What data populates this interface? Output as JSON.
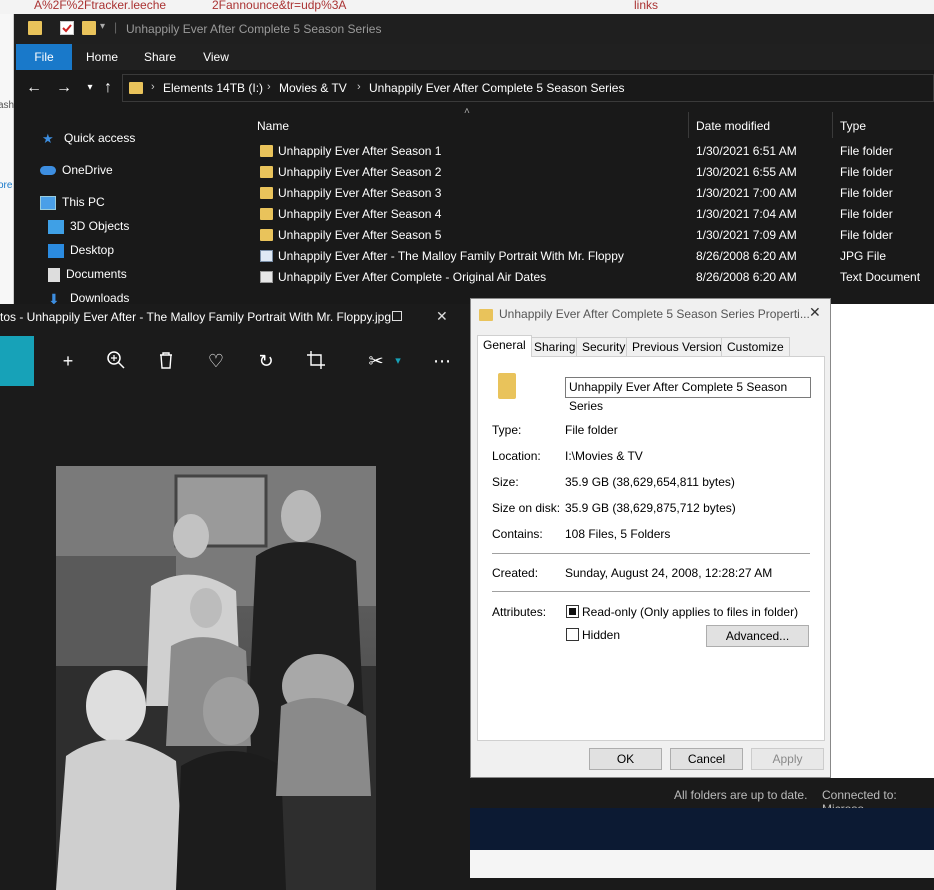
{
  "background": {
    "text1": "A%2F%2Ftracker.leeche",
    "text2": "2Fannounce&tr=udp%3A",
    "text3": "links",
    "left1": "ash",
    "left2": "ore",
    "status1": "All folders are up to date.",
    "status2": "Connected to: Microso"
  },
  "explorer": {
    "title": "Unhappily Ever After Complete 5 Season Series",
    "ribbon_tabs": [
      "File",
      "Home",
      "Share",
      "View"
    ],
    "breadcrumb": [
      "Elements 14TB (I:)",
      "Movies & TV",
      "Unhappily Ever After Complete 5 Season Series"
    ],
    "nav": {
      "quick_access": "Quick access",
      "onedrive": "OneDrive",
      "this_pc": "This PC",
      "objects3d": "3D Objects",
      "desktop": "Desktop",
      "documents": "Documents",
      "downloads": "Downloads"
    },
    "columns": {
      "name": "Name",
      "date": "Date modified",
      "type": "Type"
    },
    "files": [
      {
        "name": "Unhappily Ever After Season 1",
        "date": "1/30/2021 6:51 AM",
        "type": "File folder",
        "icon": "folder-icon"
      },
      {
        "name": "Unhappily Ever After Season 2",
        "date": "1/30/2021 6:55 AM",
        "type": "File folder",
        "icon": "folder-icon"
      },
      {
        "name": "Unhappily Ever After Season 3",
        "date": "1/30/2021 7:00 AM",
        "type": "File folder",
        "icon": "folder-icon"
      },
      {
        "name": "Unhappily Ever After Season 4",
        "date": "1/30/2021 7:04 AM",
        "type": "File folder",
        "icon": "folder-icon"
      },
      {
        "name": "Unhappily Ever After Season 5",
        "date": "1/30/2021 7:09 AM",
        "type": "File folder",
        "icon": "folder-icon"
      },
      {
        "name": "Unhappily Ever After - The Malloy Family Portrait With Mr. Floppy",
        "date": "8/26/2008 6:20 AM",
        "type": "JPG File",
        "icon": "image-file-icon"
      },
      {
        "name": "Unhappily Ever After Complete - Original Air Dates",
        "date": "8/26/2008 6:20 AM",
        "type": "Text Document",
        "icon": "text-file-icon"
      }
    ]
  },
  "photos": {
    "title": "tos - Unhappily Ever After - The Malloy Family Portrait With Mr. Floppy.jpg",
    "close_glyph": "✕"
  },
  "props": {
    "title": "Unhappily Ever After Complete 5 Season Series Properti...",
    "tabs": [
      "General",
      "Sharing",
      "Security",
      "Previous Versions",
      "Customize"
    ],
    "name_value": "Unhappily Ever After Complete 5 Season Series",
    "type_label": "Type:",
    "type_value": "File folder",
    "location_label": "Location:",
    "location_value": "I:\\Movies & TV",
    "size_label": "Size:",
    "size_value": "35.9 GB (38,629,654,811 bytes)",
    "sizeondisk_label": "Size on disk:",
    "sizeondisk_value": "35.9 GB (38,629,875,712 bytes)",
    "contains_label": "Contains:",
    "contains_value": "108 Files, 5 Folders",
    "created_label": "Created:",
    "created_value": "Sunday, August 24, 2008, 12:28:27 AM",
    "attributes_label": "Attributes:",
    "readonly_label": "Read-only (Only applies to files in folder)",
    "hidden_label": "Hidden",
    "advanced_label": "Advanced...",
    "ok_label": "OK",
    "cancel_label": "Cancel",
    "apply_label": "Apply"
  },
  "colors": {
    "accent": "#1979ca",
    "folder": "#e9c35b",
    "photos_accent": "#17a2b8"
  }
}
